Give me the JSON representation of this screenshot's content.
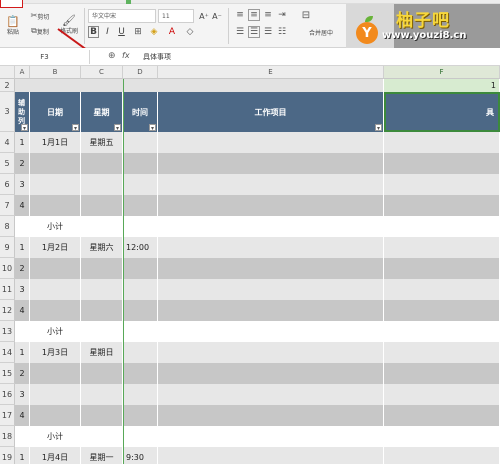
{
  "ribbon": {
    "font_name": "华文中宋",
    "font_size": "11",
    "grow_font": "A⁺",
    "shrink_font": "A⁻",
    "bold": "B",
    "italic": "I",
    "underline": "U",
    "cut_label": "剪切",
    "copy_label": "复制",
    "paste_label": "粘贴",
    "format_painter_label": "格式刷",
    "merge_label": "合并居中",
    "watermark": {
      "site_name": "柚子吧",
      "url": "www.youzi8.cn",
      "logo_letter": "Y"
    }
  },
  "formula_bar": {
    "name_box": "F3",
    "fx": "fx",
    "content": "具体事项"
  },
  "columns": [
    "A",
    "B",
    "C",
    "D",
    "E",
    "F"
  ],
  "header_row": {
    "row_number": "3",
    "helper_col": "辅助列",
    "date": "日期",
    "weekday": "星期",
    "time": "时间",
    "work_item": "工作项目",
    "detail": "具"
  },
  "row2_label": "2",
  "row2_right_text": "1",
  "rows": [
    {
      "num": "4",
      "a": "1",
      "b": "1月1日",
      "c": "星期五",
      "d": "",
      "style": "light"
    },
    {
      "num": "5",
      "a": "2",
      "b": "",
      "c": "",
      "d": "",
      "style": "dark"
    },
    {
      "num": "6",
      "a": "3",
      "b": "",
      "c": "",
      "d": "",
      "style": "light"
    },
    {
      "num": "7",
      "a": "4",
      "b": "",
      "c": "",
      "d": "",
      "style": "dark"
    },
    {
      "num": "8",
      "a": "",
      "b": "小计",
      "c": "",
      "d": "",
      "style": "plain"
    },
    {
      "num": "9",
      "a": "1",
      "b": "1月2日",
      "c": "星期六",
      "d": "12:00",
      "style": "light"
    },
    {
      "num": "10",
      "a": "2",
      "b": "",
      "c": "",
      "d": "",
      "style": "dark"
    },
    {
      "num": "11",
      "a": "3",
      "b": "",
      "c": "",
      "d": "",
      "style": "light"
    },
    {
      "num": "12",
      "a": "4",
      "b": "",
      "c": "",
      "d": "",
      "style": "dark"
    },
    {
      "num": "13",
      "a": "",
      "b": "小计",
      "c": "",
      "d": "",
      "style": "plain"
    },
    {
      "num": "14",
      "a": "1",
      "b": "1月3日",
      "c": "星期日",
      "d": "",
      "style": "light"
    },
    {
      "num": "15",
      "a": "2",
      "b": "",
      "c": "",
      "d": "",
      "style": "dark"
    },
    {
      "num": "16",
      "a": "3",
      "b": "",
      "c": "",
      "d": "",
      "style": "light"
    },
    {
      "num": "17",
      "a": "4",
      "b": "",
      "c": "",
      "d": "",
      "style": "dark"
    },
    {
      "num": "18",
      "a": "",
      "b": "小计",
      "c": "",
      "d": "",
      "style": "plain"
    },
    {
      "num": "19",
      "a": "1",
      "b": "1月4日",
      "c": "星期一",
      "d": "9:30",
      "style": "light"
    }
  ]
}
